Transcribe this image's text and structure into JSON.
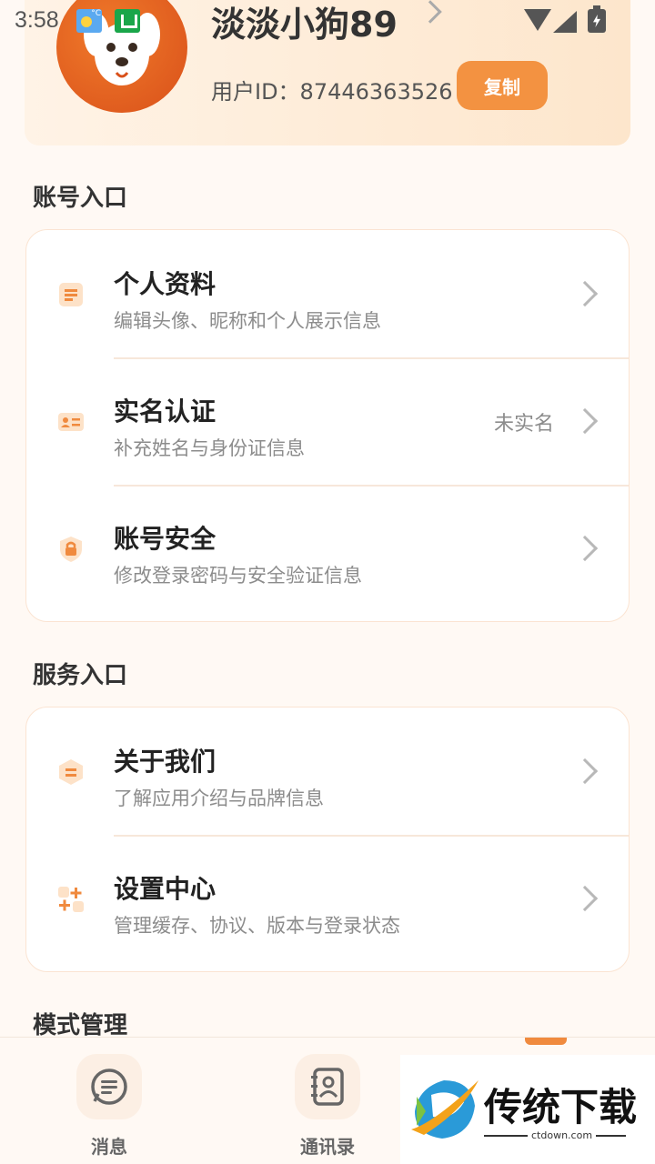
{
  "status_bar": {
    "time": "3:58",
    "weather_badge": "°C"
  },
  "profile": {
    "username": "淡淡小狗89",
    "user_id": "用户ID：87446363526",
    "copy_label": "复制"
  },
  "sections": {
    "account": {
      "title": "账号入口",
      "items": [
        {
          "title": "个人资料",
          "desc": "编辑头像、昵称和个人展示信息",
          "icon": "document-icon"
        },
        {
          "title": "实名认证",
          "desc": "补充姓名与身份证信息",
          "status": "未实名",
          "icon": "id-card-icon"
        },
        {
          "title": "账号安全",
          "desc": "修改登录密码与安全验证信息",
          "icon": "shield-lock-icon"
        }
      ]
    },
    "service": {
      "title": "服务入口",
      "items": [
        {
          "title": "关于我们",
          "desc": "了解应用介绍与品牌信息",
          "icon": "info-hexagon-icon"
        },
        {
          "title": "设置中心",
          "desc": "管理缓存、协议、版本与登录状态",
          "icon": "settings-blocks-icon"
        }
      ]
    },
    "mode": {
      "title": "模式管理"
    }
  },
  "bottom_nav": {
    "items": [
      {
        "label": "消息",
        "icon": "message-icon"
      },
      {
        "label": "通讯录",
        "icon": "contacts-icon"
      }
    ]
  },
  "watermark": {
    "brand": "传统下载",
    "domain": "ctdown.com"
  },
  "colors": {
    "accent": "#f39241",
    "background": "#fff9f4",
    "card_border": "#fbe4d2"
  }
}
